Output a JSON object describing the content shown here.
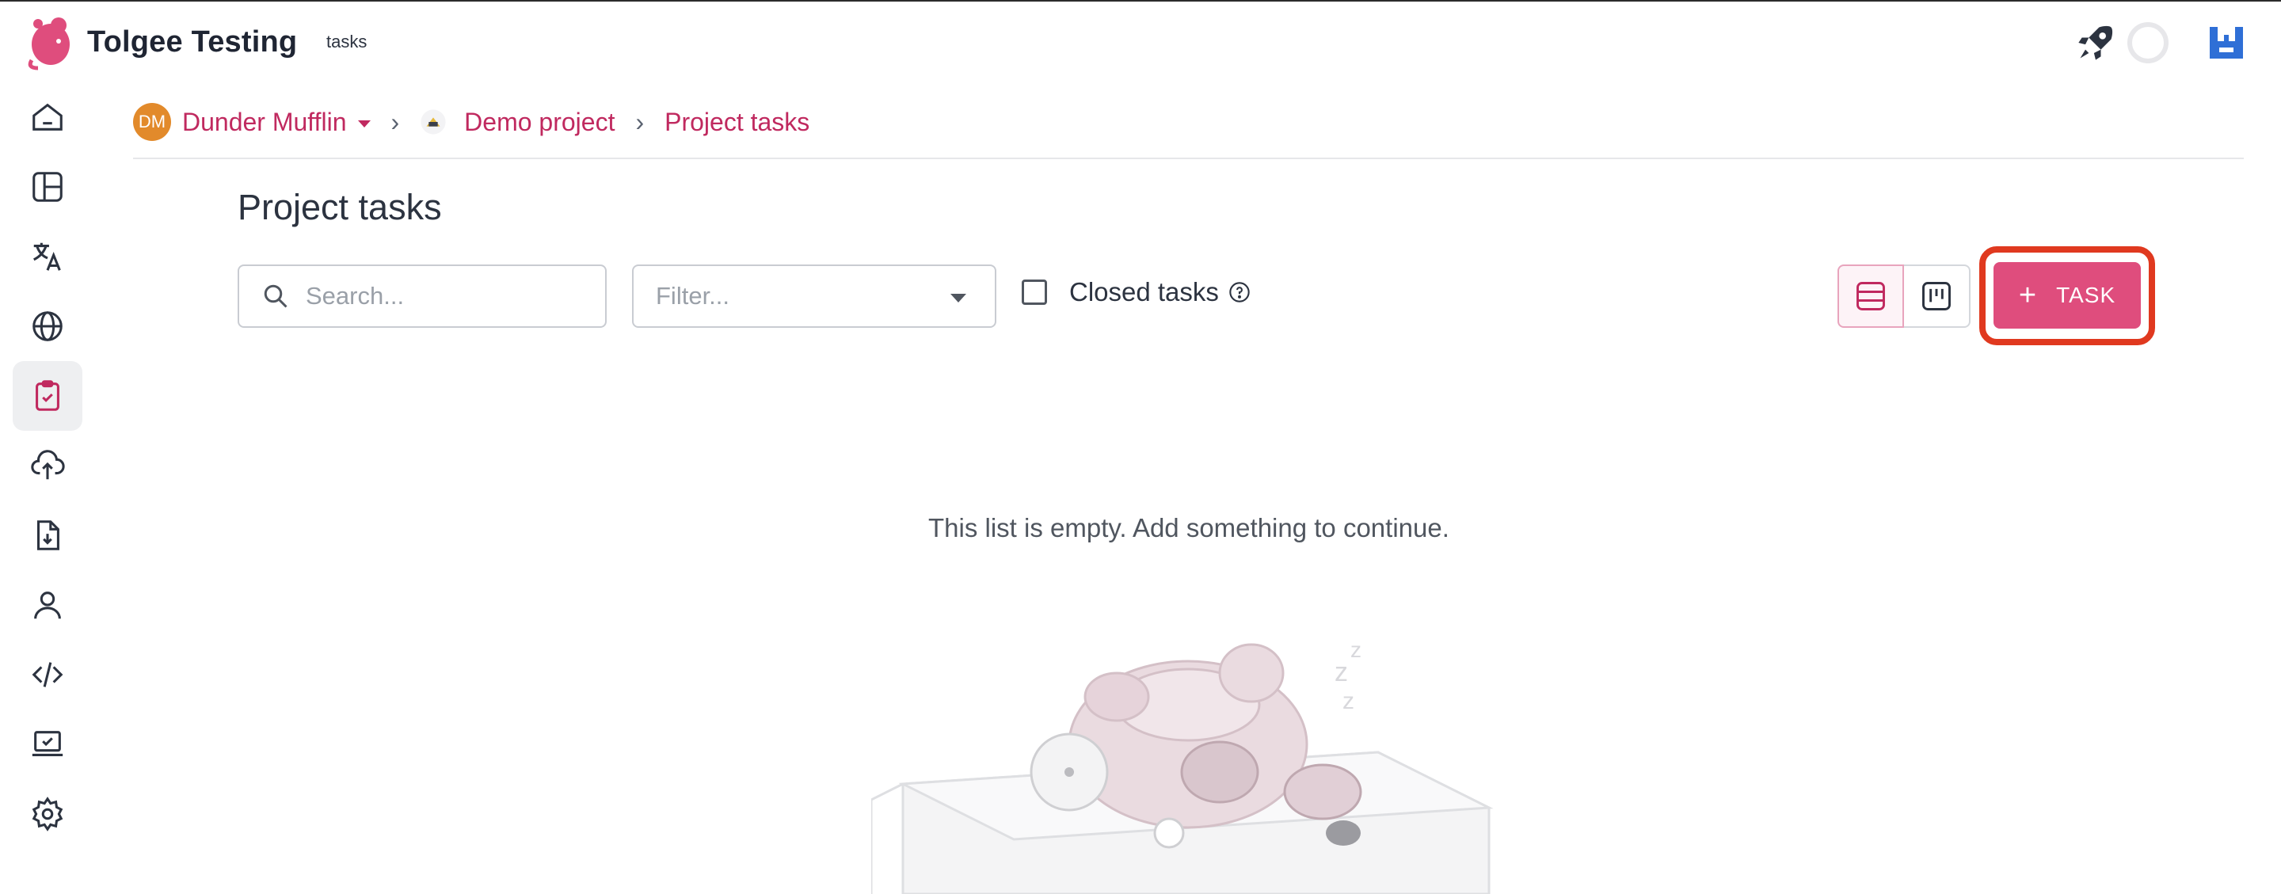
{
  "app": {
    "title": "Tolgee Testing",
    "tag": "tasks"
  },
  "colors": {
    "brand": "#df4d7d",
    "link": "#c0295f",
    "highlight": "#e0391f",
    "avatar": "#e28a2b"
  },
  "topbar": {
    "icons": [
      "rocket-icon",
      "loading-spinner",
      "user-avatar"
    ]
  },
  "sidebar": {
    "items": [
      {
        "name": "home",
        "icon": "home-icon"
      },
      {
        "name": "projects-dashboard",
        "icon": "dashboard-icon"
      },
      {
        "name": "translations",
        "icon": "translate-icon"
      },
      {
        "name": "languages",
        "icon": "globe-icon"
      },
      {
        "name": "tasks",
        "icon": "clipboard-check-icon",
        "active": true
      },
      {
        "name": "import",
        "icon": "upload-cloud-icon"
      },
      {
        "name": "export",
        "icon": "file-download-icon"
      },
      {
        "name": "members",
        "icon": "user-icon"
      },
      {
        "name": "developer",
        "icon": "code-icon"
      },
      {
        "name": "integrate",
        "icon": "laptop-check-icon"
      },
      {
        "name": "settings",
        "icon": "gear-icon"
      }
    ]
  },
  "breadcrumb": {
    "org_initials": "DM",
    "org": "Dunder Mufflin",
    "project": "Demo project",
    "current": "Project tasks"
  },
  "page": {
    "title": "Project tasks"
  },
  "toolbar": {
    "search_placeholder": "Search...",
    "filter_placeholder": "Filter...",
    "closed_tasks_label": "Closed tasks",
    "closed_tasks_checked": false,
    "view_mode": "list",
    "add_task_label": "TASK"
  },
  "empty_state": {
    "message": "This list is empty. Add something to continue."
  }
}
